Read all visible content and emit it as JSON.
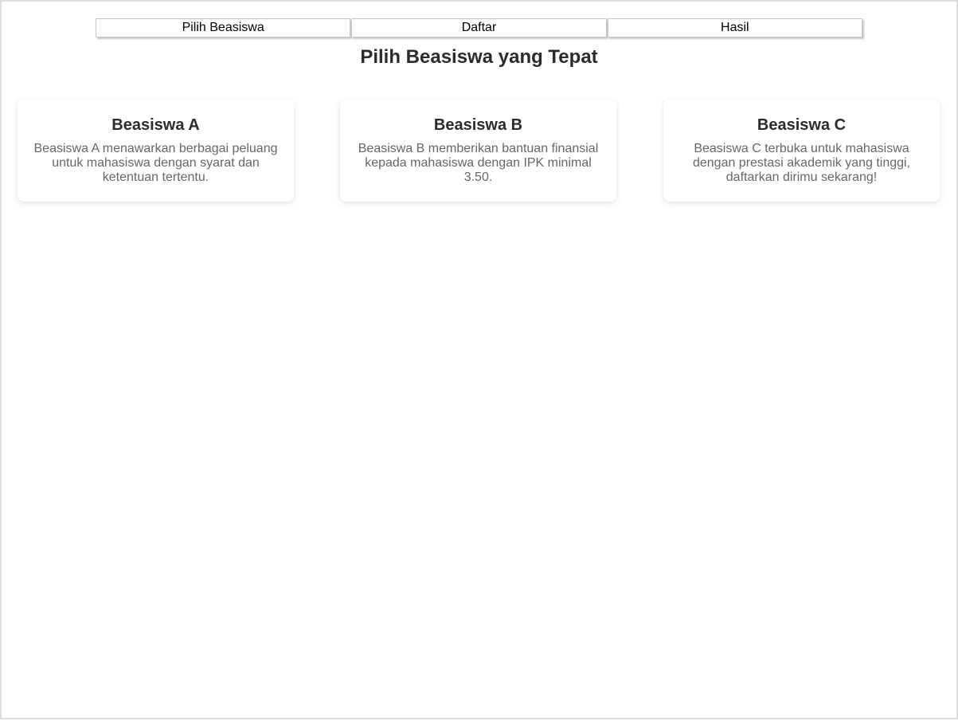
{
  "nav": {
    "tabs": [
      {
        "label": "Pilih Beasiswa"
      },
      {
        "label": "Daftar"
      },
      {
        "label": "Hasil"
      }
    ]
  },
  "main": {
    "title": "Pilih Beasiswa yang Tepat",
    "cards": [
      {
        "title": "Beasiswa A",
        "description": "Beasiswa A menawarkan berbagai peluang untuk mahasiswa dengan syarat dan ketentuan tertentu."
      },
      {
        "title": "Beasiswa B",
        "description": "Beasiswa B memberikan bantuan finansial kepada mahasiswa dengan IPK minimal 3.50."
      },
      {
        "title": "Beasiswa C",
        "description": "Beasiswa C terbuka untuk mahasiswa dengan prestasi akademik yang tinggi, daftarkan dirimu sekarang!"
      }
    ]
  }
}
